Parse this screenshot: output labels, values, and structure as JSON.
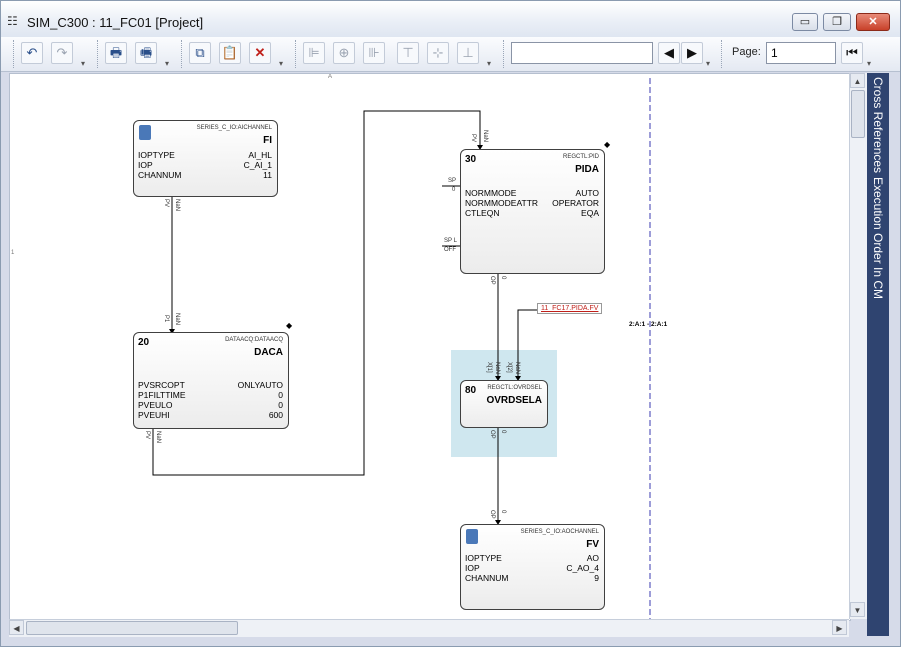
{
  "window": {
    "title": "SIM_C300 : 11_FC01 [Project]",
    "minimize_label": "▭",
    "restore_label": "❐",
    "close_label": "✕"
  },
  "toolbar": {
    "undo_icon": "↶",
    "redo_icon": "↷",
    "print_icon": "🖶",
    "print_preview_icon": "🖷",
    "copy_icon": "⧉",
    "paste_icon": "📋",
    "delete_icon": "✕",
    "align_left_icon": "⊫",
    "align_center_icon": "⊕",
    "align_right_icon": "⊪",
    "align_top_icon": "⊤",
    "align_middle_icon": "⊹",
    "align_bottom_icon": "⊥",
    "search_value": "",
    "prev_icon": "◀",
    "next_icon": "▶",
    "page_label": "Page:",
    "page_value": "1",
    "first_page_icon": "⏮",
    "dropdown_chevron": "▾"
  },
  "side_panel": {
    "tabs": [
      "Cross References",
      "Execution Order In CM"
    ]
  },
  "canvas": {
    "page_marker_top": "A",
    "page_marker_left": "1",
    "blocks": {
      "fi": {
        "type": "SERIES_C_IO:AICHANNEL",
        "name": "FI",
        "params": [
          {
            "k": "IOPTYPE",
            "v": "AI_HL"
          },
          {
            "k": "IOP",
            "v": "C_AI_1"
          },
          {
            "k": "CHANNUM",
            "v": "11"
          }
        ],
        "pin_out": "PV",
        "pin_out_status": "NaN"
      },
      "daca": {
        "number": "20",
        "type": "DATAACQ:DATAACQ",
        "name": "DACA",
        "params": [
          {
            "k": "PVSRCOPT",
            "v": "ONLYAUTO"
          },
          {
            "k": "P1FILTTIME",
            "v": "0"
          },
          {
            "k": "PVEULO",
            "v": "0"
          },
          {
            "k": "PVEUHI",
            "v": "600"
          }
        ],
        "pin_in": "P1",
        "pin_in_status": "NaN",
        "pin_out": "PV",
        "pin_out_status": "NaN"
      },
      "pida": {
        "number": "30",
        "type": "REGCTL:PID",
        "name": "PIDA",
        "params": [
          {
            "k": "NORMMODE",
            "v": "AUTO"
          },
          {
            "k": "NORMMODEATTR",
            "v": "OPERATOR"
          },
          {
            "k": "CTLEQN",
            "v": "EQA"
          }
        ],
        "pin_in": "PV",
        "pin_in_status": "NaN",
        "pin_sp": "SP",
        "pin_sp_val": "0",
        "pin_spl": "SP L",
        "pin_spl_val": "OFF",
        "pin_out": "OP",
        "pin_out_status": "0"
      },
      "ovrdsela": {
        "number": "80",
        "type": "REGCTL:OVRDSEL",
        "name": "OVRDSELA",
        "pin_x1": "X[1]",
        "pin_x1_status": "NaN",
        "pin_x2": "X[2]",
        "pin_x2_status": "NaN",
        "pin_out": "OP",
        "pin_out_status": "0"
      },
      "fv": {
        "type": "SERIES_C_IO:AOCHANNEL",
        "name": "FV",
        "params": [
          {
            "k": "IOPTYPE",
            "v": "AO"
          },
          {
            "k": "IOP",
            "v": "C_AO_4"
          },
          {
            "k": "CHANNUM",
            "v": "9"
          }
        ],
        "pin_in": "OP",
        "pin_in_status": "0"
      }
    },
    "cross_ref_label": "11_FC17.PIDA.FV",
    "ratio_label": "2:A:1 - 2:A:1",
    "diamond": "◆"
  },
  "colors": {
    "side_panel": "#2f4470",
    "highlight": "#cfe7ef",
    "page_break": "#3b3bb0",
    "cross_ref": "#c0201a"
  }
}
